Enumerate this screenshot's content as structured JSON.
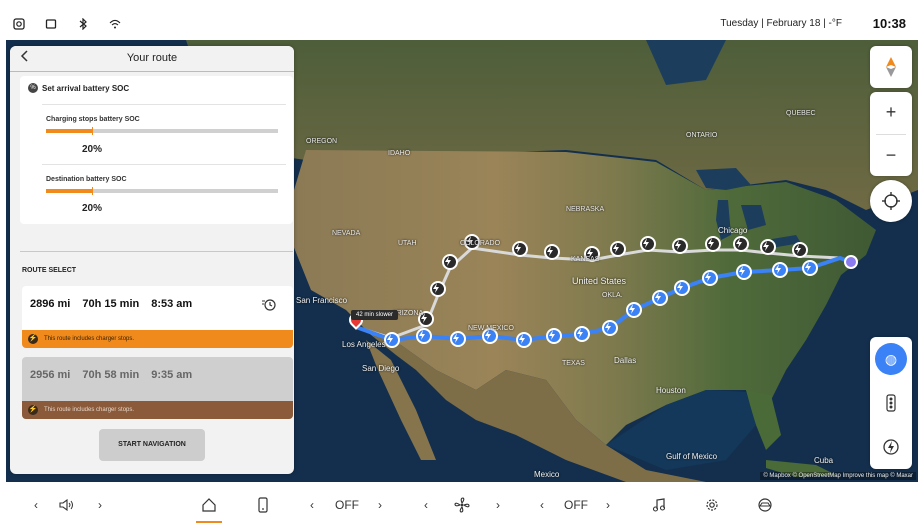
{
  "status": {
    "date": "Tuesday | February 18 | -°F",
    "time": "10:38",
    "icons": [
      "camera-icon",
      "window-icon",
      "bluetooth-icon",
      "wifi-icon"
    ]
  },
  "panel": {
    "title": "Your route",
    "soc_header": "Set arrival battery SOC",
    "charging": {
      "label": "Charging stops battery SOC",
      "value": "20%",
      "fraction": 0.2
    },
    "destination": {
      "label": "Destination battery SOC",
      "value": "20%",
      "fraction": 0.2
    },
    "route_select_label": "ROUTE SELECT",
    "routes": [
      {
        "distance": "2896 mi",
        "duration": "70h 15 min",
        "arrival": "8:53 am",
        "note": "This route includes charger stops.",
        "selected": true
      },
      {
        "distance": "2956 mi",
        "duration": "70h 58 min",
        "arrival": "9:35 am",
        "note": "This route includes charger stops.",
        "selected": false
      }
    ],
    "start_button": "START NAVIGATION"
  },
  "map": {
    "slower_tag": "42 min slower",
    "attribution": "© Mapbox © OpenStreetMap Improve this map © Maxar",
    "labels": {
      "oregon": "OREGON",
      "idaho": "IDAHO",
      "nevada": "NEVADA",
      "utah": "UTAH",
      "colorado": "COLORADO",
      "arizona": "ARIZONA",
      "new_mexico": "NEW MEXICO",
      "texas": "TEXAS",
      "kansas": "KANSAS",
      "nebraska": "NEBRASKA",
      "oklahoma": "OKLA.",
      "united_states": "United States",
      "mexico": "Mexico",
      "gulf": "Gulf of Mexico",
      "san_francisco": "San Francisco",
      "los_angeles": "Los Angeles",
      "san_diego": "San Diego",
      "dallas": "Dallas",
      "houston": "Houston",
      "chicago": "Chicago",
      "ontario": "ONTARIO",
      "quebec": "QUEBEC",
      "cuba": "Cuba"
    },
    "accent": "#3b82f6",
    "alt_route_color": "#d9d9d9"
  },
  "bottom_bar": {
    "fan_left": "OFF",
    "fan_right": "OFF"
  },
  "colors": {
    "orange": "#f08a1c",
    "brown": "#8a5a3a",
    "blue": "#3b82f6"
  }
}
